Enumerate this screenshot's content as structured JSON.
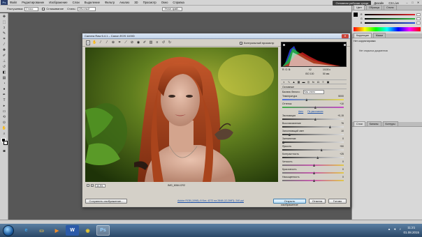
{
  "menubar": {
    "logo": "Ps",
    "items": [
      "Файл",
      "Редактирование",
      "Изображение",
      "Слои",
      "Выделение",
      "Фильтр",
      "Анализ",
      "3D",
      "Просмотр",
      "Окно",
      "Справка"
    ],
    "workspace": "Основная рабочая среда",
    "design": "Дизайн",
    "cslive": "CS Live"
  },
  "optbar": {
    "feather_label": "Растушевка:",
    "feather_value": "0 пикс",
    "antialias": "Сглаживание",
    "style_label": "Стиль:",
    "style_value": "Обычный",
    "refine": "Уточн. край..."
  },
  "rightpanel": {
    "tabs": [
      "Цвет",
      "Образцы",
      "Стили"
    ],
    "channels": [
      {
        "label": "R",
        "color": "#e0262b"
      },
      {
        "label": "G",
        "color": "#2ab23a"
      },
      {
        "label": "B",
        "color": "#2650e0"
      }
    ],
    "adjust_tabs": [
      "Коррекция",
      "Маски"
    ],
    "adjust_title": "Нет корректировки",
    "adjust_hint": "Нет открытых документов",
    "layers_tabs": [
      "Слои",
      "Каналы",
      "Контуры"
    ]
  },
  "dialog": {
    "title": "Camera Raw 6.4.1 – Canon EOS 1100D",
    "preview_label": "Контрольный просмотр",
    "zoom": "30,9%",
    "filename": "IMG_6064.CR2",
    "exif": {
      "aperture": "f/2",
      "shutter": "1/100 с",
      "iso": "ISO 100",
      "focal": "50 мм"
    },
    "rgb": "R:  G:  B:",
    "basic_title": "Основные",
    "wb_label": "Баланс белого:",
    "wb_value": "Как снято",
    "auto_link": "Авто",
    "default_link": "По умолчанию",
    "adjustments": [
      {
        "name": "Температура",
        "value": "5000",
        "pos": 0.38
      },
      {
        "name": "Оттенок",
        "value": "+10",
        "pos": 0.52
      },
      {
        "name": "Экспозиция",
        "value": "+0,15",
        "pos": 0.52
      },
      {
        "name": "Восстановление",
        "value": "76",
        "pos": 0.76
      },
      {
        "name": "Заполняющий свет",
        "value": "10",
        "pos": 0.1
      },
      {
        "name": "Затемнение",
        "value": "0",
        "pos": 0.0
      },
      {
        "name": "Яркость",
        "value": "+50",
        "pos": 0.62
      },
      {
        "name": "Контрастность",
        "value": "+25",
        "pos": 0.56
      },
      {
        "name": "Четкость",
        "value": "0",
        "pos": 0.5
      },
      {
        "name": "Красочность",
        "value": "0",
        "pos": 0.5
      },
      {
        "name": "Насыщенность",
        "value": "0",
        "pos": 0.5
      }
    ],
    "buttons": {
      "save": "Сохранить изображение...",
      "workflow": "Adobe RGB (1998); 8 бит; 4272 на 2848 (12,2МП); 240 ppi",
      "open": "Открыть изображение",
      "cancel": "Отмена",
      "done": "Готово"
    }
  },
  "taskbar": {
    "time": "11:21",
    "date": "01.08.2015",
    "items": [
      "ie",
      "explorer",
      "media",
      "word",
      "chrome",
      "photoshop"
    ]
  }
}
